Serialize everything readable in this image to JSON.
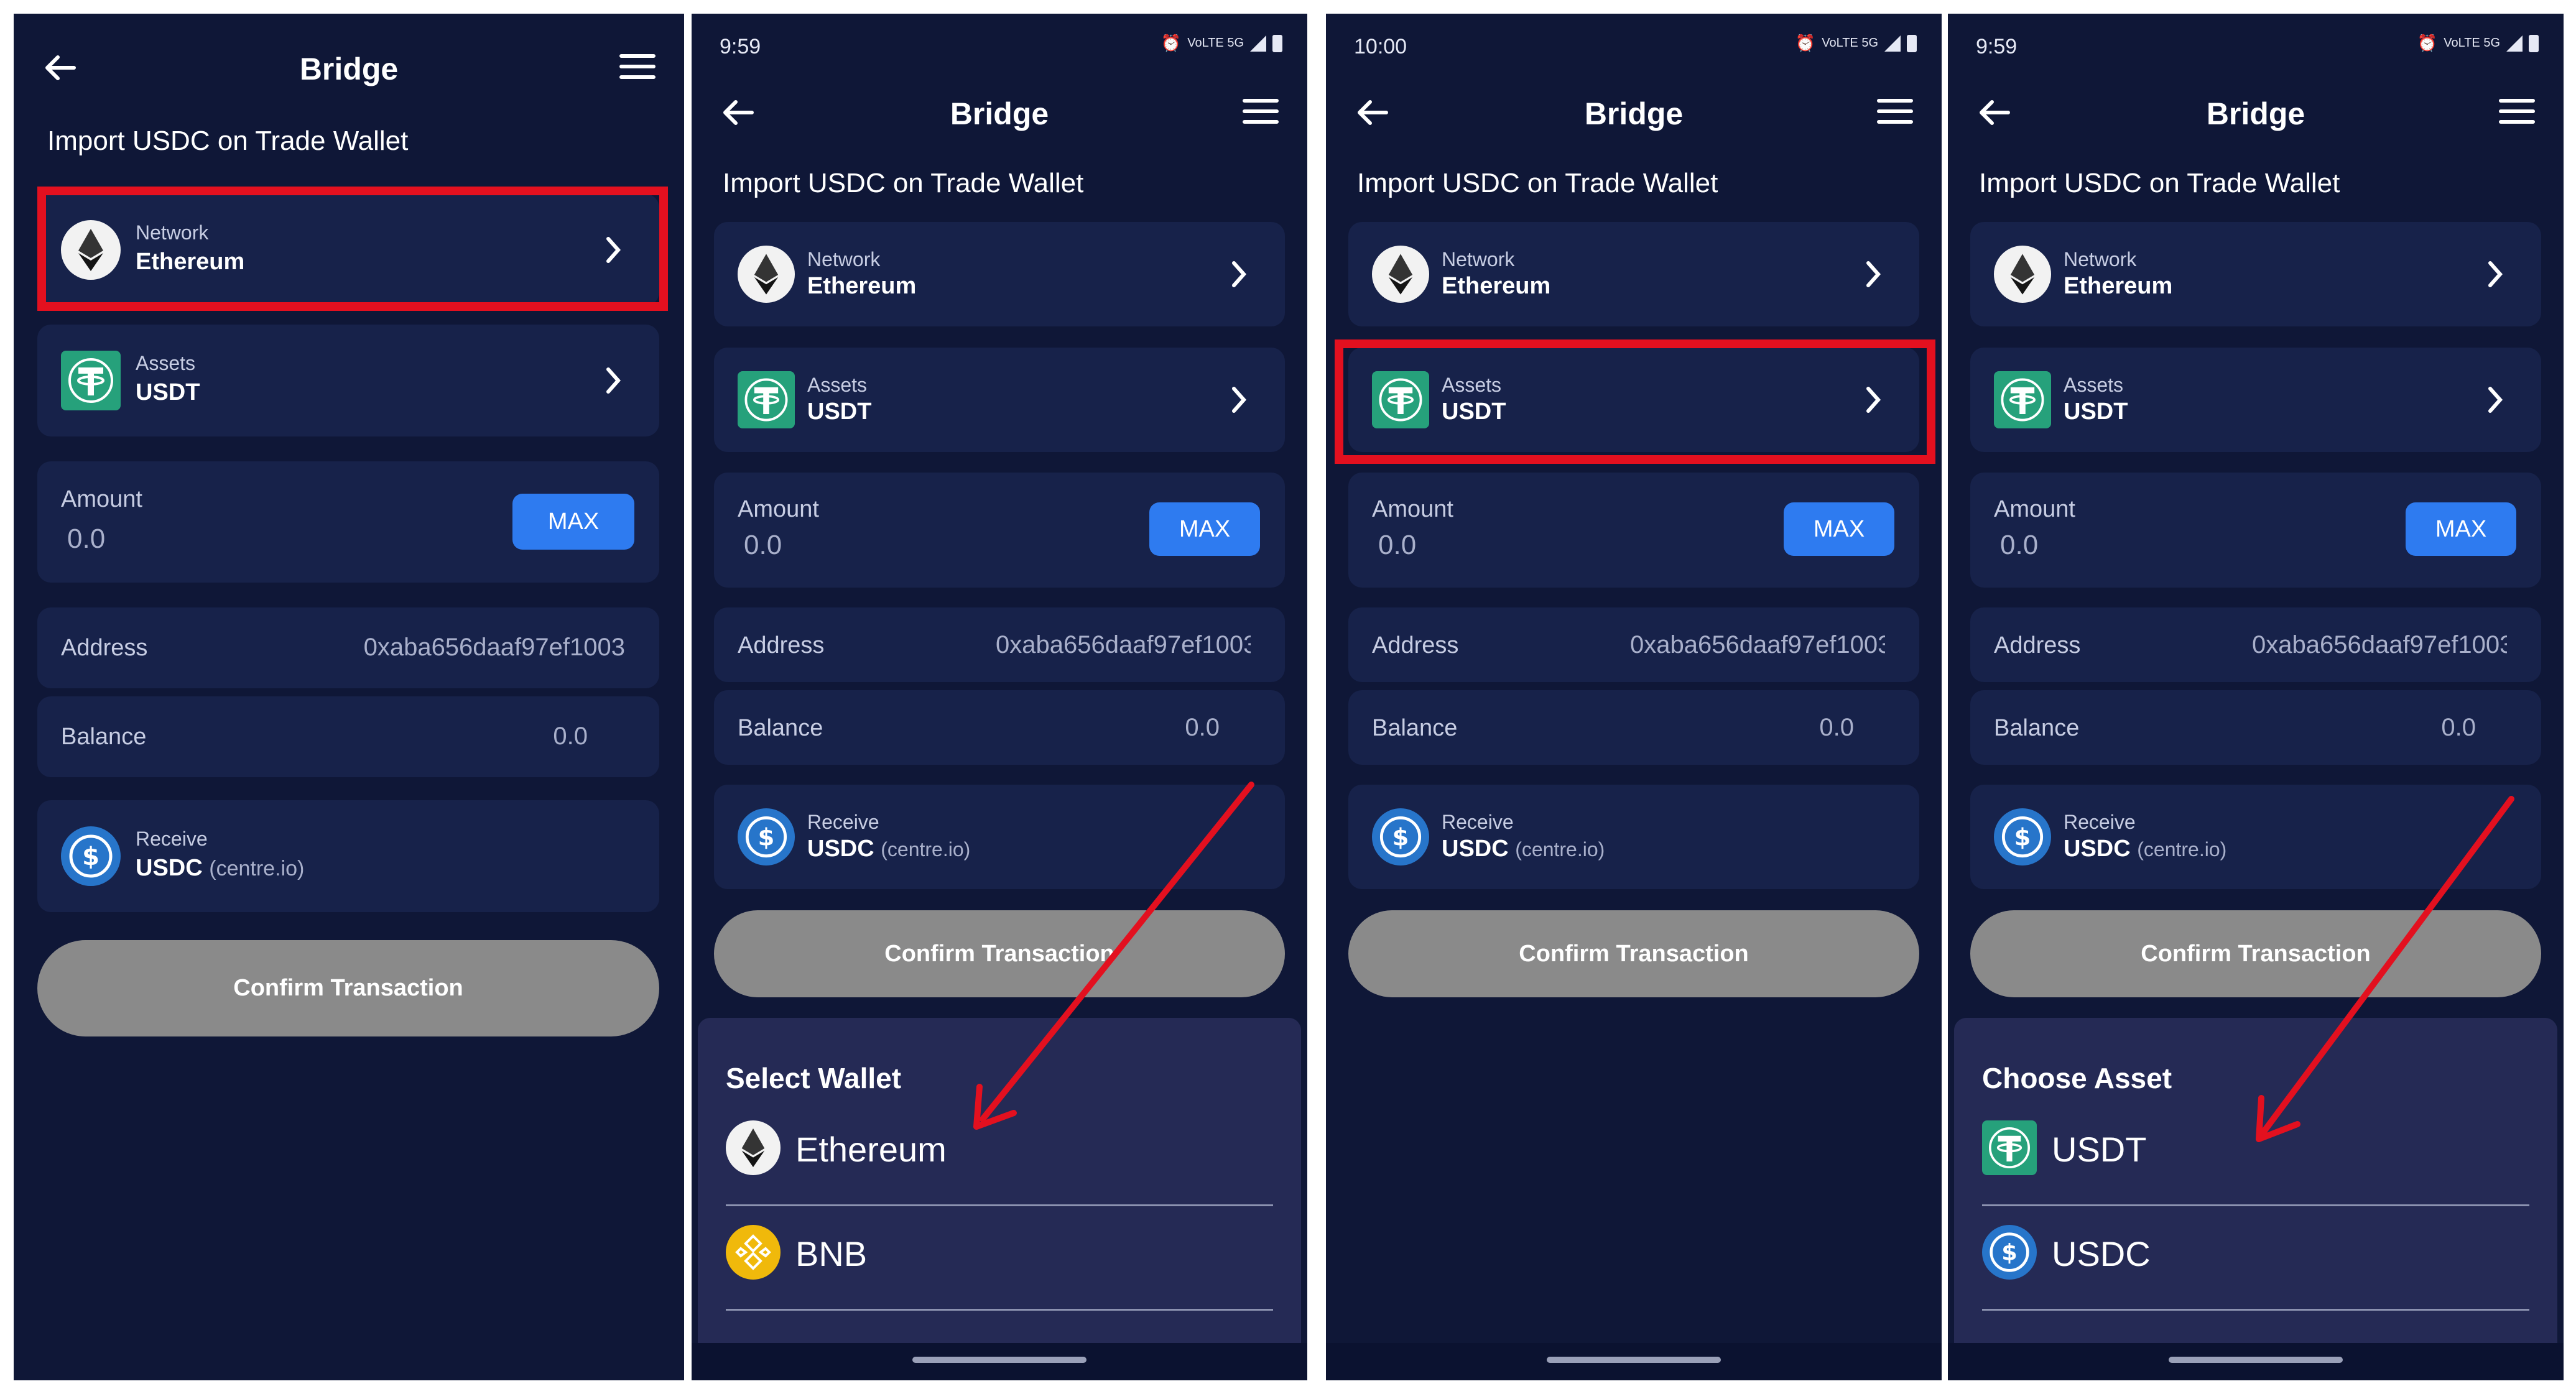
{
  "colors": {
    "panel_bg": "#0f1737",
    "card_bg": "#17224a",
    "accent": "#2e7bf0",
    "confirm_bg": "#8a8a8a",
    "highlight": "#e3101f",
    "sheet_bg": "#252a55"
  },
  "header": {
    "title": "Bridge"
  },
  "page": {
    "subtitle": "Import USDC on Trade Wallet"
  },
  "network": {
    "caption": "Network",
    "value": "Ethereum",
    "icon": "ethereum-icon"
  },
  "assets": {
    "caption": "Assets",
    "value": "USDT",
    "icon": "usdt-icon"
  },
  "amount": {
    "label": "Amount",
    "value": "0.0",
    "max_label": "MAX"
  },
  "address": {
    "label": "Address",
    "value": "0xaba656daaf97ef1003"
  },
  "balance": {
    "label": "Balance",
    "value": "0.0"
  },
  "receive": {
    "caption": "Receive",
    "token": "USDC",
    "source": "(centre.io)",
    "icon": "usdc-icon"
  },
  "confirm": {
    "label": "Confirm Transaction"
  },
  "panels": [
    {
      "status_time": ""
    },
    {
      "status_time": "9:59",
      "status_icons": "VoLTE 5G"
    },
    {
      "status_time": "10:00",
      "status_icons": "VoLTE 5G"
    },
    {
      "status_time": "9:59",
      "status_icons": "VoLTE 5G"
    }
  ],
  "select_wallet": {
    "title": "Select Wallet",
    "options": [
      {
        "label": "Ethereum",
        "icon": "ethereum-icon"
      },
      {
        "label": "BNB",
        "icon": "bnb-icon"
      }
    ]
  },
  "choose_asset": {
    "title": "Choose Asset",
    "options": [
      {
        "label": "USDT",
        "icon": "usdt-icon"
      },
      {
        "label": "USDC",
        "icon": "usdc-icon"
      }
    ]
  }
}
